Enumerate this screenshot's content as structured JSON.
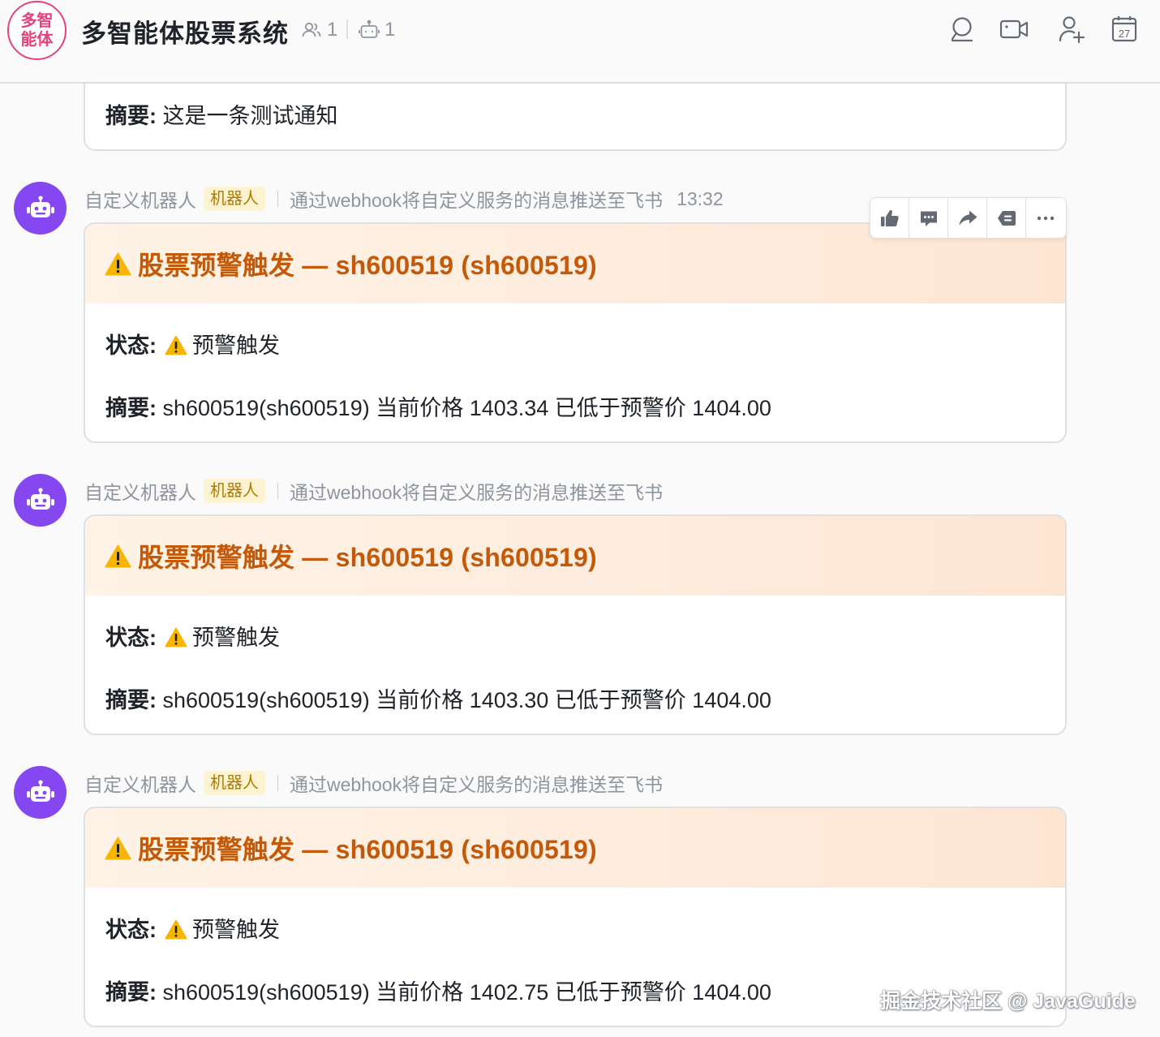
{
  "header": {
    "avatar_line1": "多智",
    "avatar_line2": "能体",
    "title": "多智能体股票系统",
    "member_count": "1",
    "bot_count": "1",
    "calendar_day": "27",
    "icons": [
      "group-members-icon",
      "bot-icon",
      "search-icon",
      "video-call-icon",
      "add-member-icon",
      "calendar-icon"
    ],
    "avatar_color": "#e6417d"
  },
  "prev_card": {
    "summary_key": "摘要",
    "summary_value": "这是一条测试通知"
  },
  "messages": [
    {
      "sender": "自定义机器人",
      "badge": "机器人",
      "description": "通过webhook将自定义服务的消息推送至飞书",
      "time": "13:32",
      "title": "股票预警触发 — sh600519 (sh600519)",
      "status_key": "状态",
      "status_value": "预警触发",
      "summary_key": "摘要",
      "summary_value": "sh600519(sh600519) 当前价格 1403.34 已低于预警价 1404.00"
    },
    {
      "sender": "自定义机器人",
      "badge": "机器人",
      "description": "通过webhook将自定义服务的消息推送至飞书",
      "title": "股票预警触发 — sh600519 (sh600519)",
      "status_key": "状态",
      "status_value": "预警触发",
      "summary_key": "摘要",
      "summary_value": "sh600519(sh600519) 当前价格 1403.30 已低于预警价 1404.00"
    },
    {
      "sender": "自定义机器人",
      "badge": "机器人",
      "description": "通过webhook将自定义服务的消息推送至飞书",
      "title": "股票预警触发 — sh600519 (sh600519)",
      "status_key": "状态",
      "status_value": "预警触发",
      "summary_key": "摘要",
      "summary_value": "sh600519(sh600519) 当前价格 1402.75 已低于预警价 1404.00"
    }
  ],
  "toolbar": {
    "icons": [
      "thumbs-up-icon",
      "reply-icon",
      "forward-icon",
      "quote-icon",
      "more-icon"
    ]
  },
  "watermark": "掘金技术社区 @ JavaGuide",
  "colors": {
    "bot_avatar": "#8547f0",
    "card_title": "#c45a09",
    "badge_bg": "#fdf3d0",
    "badge_text": "#b27b00",
    "warning": "#f7b500"
  }
}
